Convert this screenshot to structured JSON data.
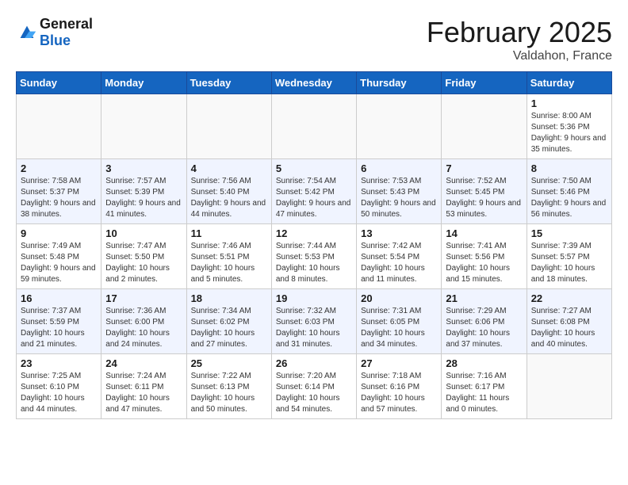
{
  "header": {
    "logo_line1": "General",
    "logo_line2": "Blue",
    "month": "February 2025",
    "location": "Valdahon, France"
  },
  "weekdays": [
    "Sunday",
    "Monday",
    "Tuesday",
    "Wednesday",
    "Thursday",
    "Friday",
    "Saturday"
  ],
  "weeks": [
    [
      {
        "day": "",
        "info": ""
      },
      {
        "day": "",
        "info": ""
      },
      {
        "day": "",
        "info": ""
      },
      {
        "day": "",
        "info": ""
      },
      {
        "day": "",
        "info": ""
      },
      {
        "day": "",
        "info": ""
      },
      {
        "day": "1",
        "info": "Sunrise: 8:00 AM\nSunset: 5:36 PM\nDaylight: 9 hours\nand 35 minutes."
      }
    ],
    [
      {
        "day": "2",
        "info": "Sunrise: 7:58 AM\nSunset: 5:37 PM\nDaylight: 9 hours\nand 38 minutes."
      },
      {
        "day": "3",
        "info": "Sunrise: 7:57 AM\nSunset: 5:39 PM\nDaylight: 9 hours\nand 41 minutes."
      },
      {
        "day": "4",
        "info": "Sunrise: 7:56 AM\nSunset: 5:40 PM\nDaylight: 9 hours\nand 44 minutes."
      },
      {
        "day": "5",
        "info": "Sunrise: 7:54 AM\nSunset: 5:42 PM\nDaylight: 9 hours\nand 47 minutes."
      },
      {
        "day": "6",
        "info": "Sunrise: 7:53 AM\nSunset: 5:43 PM\nDaylight: 9 hours\nand 50 minutes."
      },
      {
        "day": "7",
        "info": "Sunrise: 7:52 AM\nSunset: 5:45 PM\nDaylight: 9 hours\nand 53 minutes."
      },
      {
        "day": "8",
        "info": "Sunrise: 7:50 AM\nSunset: 5:46 PM\nDaylight: 9 hours\nand 56 minutes."
      }
    ],
    [
      {
        "day": "9",
        "info": "Sunrise: 7:49 AM\nSunset: 5:48 PM\nDaylight: 9 hours\nand 59 minutes."
      },
      {
        "day": "10",
        "info": "Sunrise: 7:47 AM\nSunset: 5:50 PM\nDaylight: 10 hours\nand 2 minutes."
      },
      {
        "day": "11",
        "info": "Sunrise: 7:46 AM\nSunset: 5:51 PM\nDaylight: 10 hours\nand 5 minutes."
      },
      {
        "day": "12",
        "info": "Sunrise: 7:44 AM\nSunset: 5:53 PM\nDaylight: 10 hours\nand 8 minutes."
      },
      {
        "day": "13",
        "info": "Sunrise: 7:42 AM\nSunset: 5:54 PM\nDaylight: 10 hours\nand 11 minutes."
      },
      {
        "day": "14",
        "info": "Sunrise: 7:41 AM\nSunset: 5:56 PM\nDaylight: 10 hours\nand 15 minutes."
      },
      {
        "day": "15",
        "info": "Sunrise: 7:39 AM\nSunset: 5:57 PM\nDaylight: 10 hours\nand 18 minutes."
      }
    ],
    [
      {
        "day": "16",
        "info": "Sunrise: 7:37 AM\nSunset: 5:59 PM\nDaylight: 10 hours\nand 21 minutes."
      },
      {
        "day": "17",
        "info": "Sunrise: 7:36 AM\nSunset: 6:00 PM\nDaylight: 10 hours\nand 24 minutes."
      },
      {
        "day": "18",
        "info": "Sunrise: 7:34 AM\nSunset: 6:02 PM\nDaylight: 10 hours\nand 27 minutes."
      },
      {
        "day": "19",
        "info": "Sunrise: 7:32 AM\nSunset: 6:03 PM\nDaylight: 10 hours\nand 31 minutes."
      },
      {
        "day": "20",
        "info": "Sunrise: 7:31 AM\nSunset: 6:05 PM\nDaylight: 10 hours\nand 34 minutes."
      },
      {
        "day": "21",
        "info": "Sunrise: 7:29 AM\nSunset: 6:06 PM\nDaylight: 10 hours\nand 37 minutes."
      },
      {
        "day": "22",
        "info": "Sunrise: 7:27 AM\nSunset: 6:08 PM\nDaylight: 10 hours\nand 40 minutes."
      }
    ],
    [
      {
        "day": "23",
        "info": "Sunrise: 7:25 AM\nSunset: 6:10 PM\nDaylight: 10 hours\nand 44 minutes."
      },
      {
        "day": "24",
        "info": "Sunrise: 7:24 AM\nSunset: 6:11 PM\nDaylight: 10 hours\nand 47 minutes."
      },
      {
        "day": "25",
        "info": "Sunrise: 7:22 AM\nSunset: 6:13 PM\nDaylight: 10 hours\nand 50 minutes."
      },
      {
        "day": "26",
        "info": "Sunrise: 7:20 AM\nSunset: 6:14 PM\nDaylight: 10 hours\nand 54 minutes."
      },
      {
        "day": "27",
        "info": "Sunrise: 7:18 AM\nSunset: 6:16 PM\nDaylight: 10 hours\nand 57 minutes."
      },
      {
        "day": "28",
        "info": "Sunrise: 7:16 AM\nSunset: 6:17 PM\nDaylight: 11 hours\nand 0 minutes."
      },
      {
        "day": "",
        "info": ""
      }
    ]
  ]
}
